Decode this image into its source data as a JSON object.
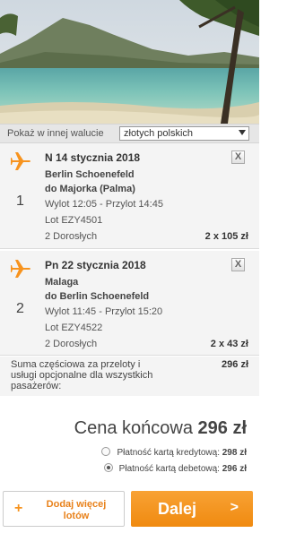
{
  "currency": {
    "label": "Pokaż w innej walucie",
    "selected": "złotych polskich"
  },
  "flights": [
    {
      "segment": "1",
      "date": "N 14 stycznia 2018",
      "route_from": "Berlin Schoenefeld",
      "route_to": "do Majorka (Palma)",
      "times": "Wylot 12:05 - Przylot 14:45",
      "flight_code": "Lot EZY4501",
      "passengers": "2 Dorosłych",
      "price": "2 x 105 zł",
      "close_label": "X"
    },
    {
      "segment": "2",
      "date": "Pn 22 stycznia 2018",
      "route_from": "Malaga",
      "route_to": "do Berlin Schoenefeld",
      "times": "Wylot 11:45 - Przylot 15:20",
      "flight_code": "Lot EZY4522",
      "passengers": "2 Dorosłych",
      "price": "2 x 43 zł",
      "close_label": "X"
    }
  ],
  "subtotal": {
    "label": "Suma częściowa za przeloty i usługi opcjonalne dla wszystkich pasażerów:",
    "value": "296 zł"
  },
  "total": {
    "label": "Cena końcowa",
    "value": "296 zł"
  },
  "payment_options": [
    {
      "label": "Płatność kartą kredytową:",
      "value": "298 zł",
      "selected": false
    },
    {
      "label": "Płatność kartą debetową:",
      "value": "296 zł",
      "selected": true
    }
  ],
  "buttons": {
    "add_flights": "Dodaj więcej lotów",
    "add_icon": "+",
    "next": "Dalej",
    "next_icon": ">"
  },
  "colors": {
    "accent": "#f7931e",
    "panel": "#f4f4f4"
  },
  "icons": {
    "flight": "plane-icon",
    "close": "close-icon",
    "add": "plus-icon",
    "next": "chevron-right-icon"
  }
}
